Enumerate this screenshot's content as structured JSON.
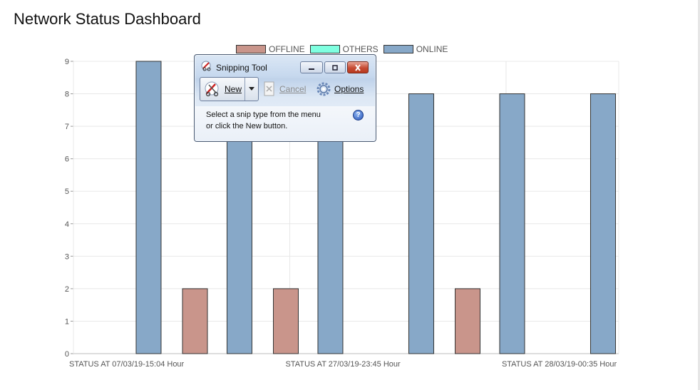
{
  "page": {
    "title": "Network Status Dashboard"
  },
  "colors": {
    "offline": "#c9958b",
    "others": "#7fffe0",
    "online": "#87a8c8",
    "bar_stroke": "#333333",
    "grid": "#e8e8e8"
  },
  "chart_data": {
    "type": "bar",
    "categories": [
      "STATUS AT 07/03/19-15:04 Hour",
      "STATUS AT 27/03/19-23:45 Hour",
      "STATUS AT 28/03/19-00:35 Hour"
    ],
    "ylim": [
      0,
      9
    ],
    "yticks": [
      0,
      1,
      2,
      3,
      4,
      5,
      6,
      7,
      8,
      9
    ],
    "legend_position": "top-center",
    "grid": true,
    "series": [
      {
        "name": "OFFLINE",
        "color": "#c9958b",
        "values": [
          null,
          2,
          2,
          null,
          2,
          null
        ]
      },
      {
        "name": "OTHERS",
        "color": "#7fffe0",
        "values": [
          null,
          null,
          null,
          null,
          null,
          null
        ]
      },
      {
        "name": "ONLINE",
        "color": "#87a8c8",
        "values": [
          9,
          8,
          8,
          8,
          8,
          8
        ]
      }
    ]
  },
  "snipping_tool": {
    "title": "Snipping Tool",
    "new_label": "New",
    "cancel_label": "Cancel",
    "options_label": "Options",
    "message_line1": "Select a snip type from the menu",
    "message_line2": "or click the New button.",
    "min_icon": "minimize-icon",
    "max_icon": "maximize-icon",
    "close_icon": "close-icon"
  }
}
